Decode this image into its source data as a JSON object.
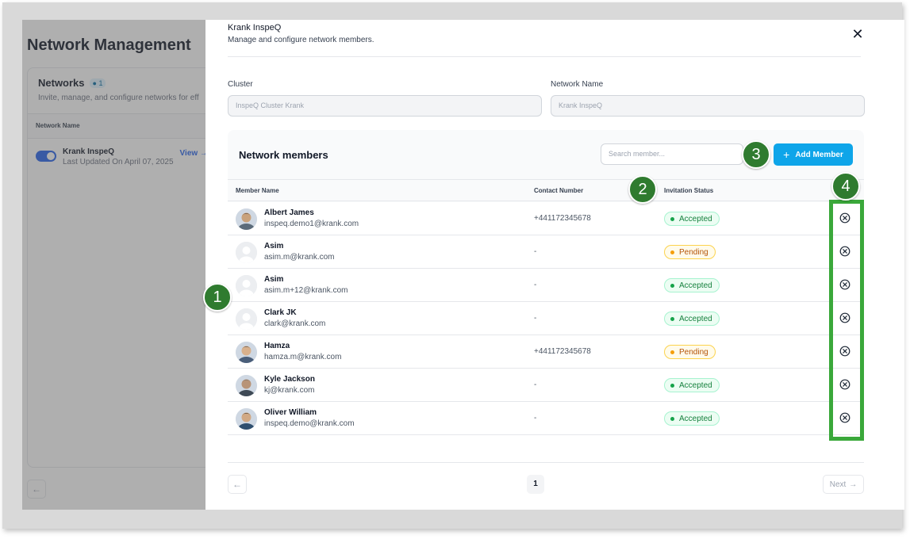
{
  "background_app": {
    "title": "Network Management",
    "networks_label": "Networks",
    "networks_count": "1",
    "networks_desc": "Invite, manage, and configure networks for eff",
    "column_network_name": "Network Name",
    "row_name": "Krank InspeQ",
    "row_updated": "Last Updated On April 07, 2025",
    "row_view": "View →",
    "prev_arrow": "←"
  },
  "drawer": {
    "title": "Krank InspeQ",
    "subtitle": "Manage and configure network members.",
    "close_symbol": "✕"
  },
  "form": {
    "cluster_label": "Cluster",
    "cluster_value": "InspeQ Cluster Krank",
    "network_name_label": "Network Name",
    "network_name_value": "Krank InspeQ"
  },
  "members_panel": {
    "title": "Network members",
    "search_placeholder": "Search member...",
    "add_button": "Add Member",
    "add_icon": "+",
    "columns": {
      "member_name": "Member Name",
      "contact_number": "Contact Number",
      "invitation_status": "Invitation Status"
    },
    "rows": [
      {
        "name": "Albert James",
        "email": "inspeq.demo1@krank.com",
        "contact": "+441172345678",
        "status": "Accepted",
        "avatar": "photo"
      },
      {
        "name": "Asim",
        "email": "asim.m@krank.com",
        "contact": "-",
        "status": "Pending",
        "avatar": "placeholder"
      },
      {
        "name": "Asim",
        "email": "asim.m+12@krank.com",
        "contact": "-",
        "status": "Accepted",
        "avatar": "placeholder"
      },
      {
        "name": "Clark JK",
        "email": "clark@krank.com",
        "contact": "-",
        "status": "Accepted",
        "avatar": "placeholder"
      },
      {
        "name": "Hamza",
        "email": "hamza.m@krank.com",
        "contact": "+441172345678",
        "status": "Pending",
        "avatar": "photo"
      },
      {
        "name": "Kyle Jackson",
        "email": "kj@krank.com",
        "contact": "-",
        "status": "Accepted",
        "avatar": "photo"
      },
      {
        "name": "Oliver William",
        "email": "inspeq.demo@krank.com",
        "contact": "-",
        "status": "Accepted",
        "avatar": "photo"
      }
    ]
  },
  "pagination": {
    "prev": "←",
    "current_page": "1",
    "next": "Next",
    "next_arrow": "→"
  },
  "markers": [
    "1",
    "2",
    "3",
    "4"
  ],
  "colors": {
    "accent": "#0ea5e9",
    "marker": "#2f7b2f",
    "highlight": "#3aa83a",
    "accepted": "#16a34a",
    "pending": "#f59e0b"
  }
}
